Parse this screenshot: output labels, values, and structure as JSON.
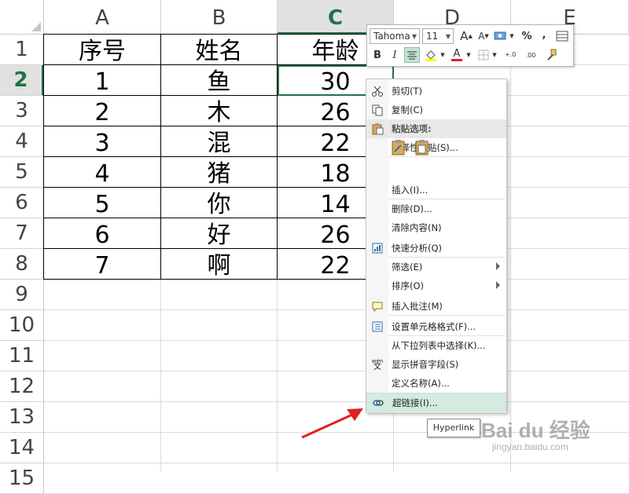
{
  "sheet": {
    "columns": [
      "A",
      "B",
      "C",
      "D",
      "E"
    ],
    "active_column": "C",
    "rows": [
      "1",
      "2",
      "3",
      "4",
      "5",
      "6",
      "7",
      "8",
      "9",
      "10",
      "11",
      "12",
      "13",
      "14",
      "15"
    ],
    "active_row": "2",
    "table": [
      [
        "序号",
        "姓名",
        "年龄"
      ],
      [
        "1",
        "鱼",
        "30"
      ],
      [
        "2",
        "木",
        "26"
      ],
      [
        "3",
        "混",
        "22"
      ],
      [
        "4",
        "猪",
        "18"
      ],
      [
        "5",
        "你",
        "14"
      ],
      [
        "6",
        "好",
        "26"
      ],
      [
        "7",
        "啊",
        "22"
      ]
    ],
    "selected_cell": "C2",
    "accent_color": "#217346"
  },
  "mini_toolbar": {
    "font_name": "Tahoma",
    "font_size": "11",
    "grow_font": "A",
    "shrink_font": "A",
    "percent": "%",
    "comma": ",",
    "bold": "B",
    "italic": "I",
    "font_color": "A",
    "increase_decimal": "+.0",
    "decrease_decimal": ".00"
  },
  "context_menu": {
    "items": [
      {
        "label": "剪切(T)",
        "icon": "scissors-icon"
      },
      {
        "label": "复制(C)",
        "icon": "copy-icon"
      },
      {
        "label": "粘贴选项:",
        "icon": "paste-icon",
        "header": true
      },
      {
        "label": "选择性粘贴(S)...",
        "icon": ""
      },
      {
        "label": "插入(I)...",
        "icon": ""
      },
      {
        "label": "删除(D)...",
        "icon": ""
      },
      {
        "label": "清除内容(N)",
        "icon": ""
      },
      {
        "label": "快速分析(Q)",
        "icon": "quick-analysis-icon"
      },
      {
        "label": "筛选(E)",
        "icon": "",
        "submenu": true
      },
      {
        "label": "排序(O)",
        "icon": "",
        "submenu": true
      },
      {
        "label": "插入批注(M)",
        "icon": "comment-icon"
      },
      {
        "label": "设置单元格格式(F)...",
        "icon": "format-cells-icon"
      },
      {
        "label": "从下拉列表中选择(K)...",
        "icon": ""
      },
      {
        "label": "显示拼音字段(S)",
        "icon": "phonetic-icon"
      },
      {
        "label": "定义名称(A)...",
        "icon": ""
      },
      {
        "label": "超链接(I)...",
        "icon": "hyperlink-icon",
        "hover": true
      }
    ],
    "phonetic_icon_text": "wén",
    "phonetic_icon_char": "文"
  },
  "tooltip": {
    "text": "Hyperlink"
  },
  "watermark": {
    "brand": "Bai du 经验",
    "url": "jingyan.baidu.com"
  },
  "annotation": {
    "arrow_color": "#e02020"
  }
}
